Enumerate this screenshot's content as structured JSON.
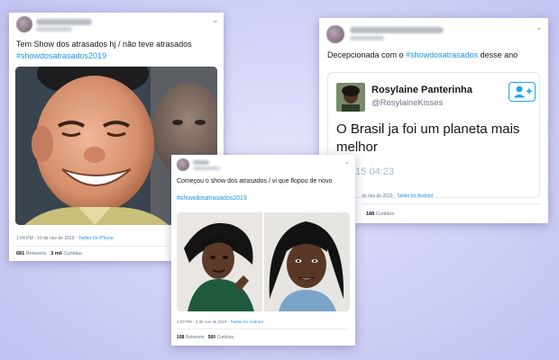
{
  "tweets": [
    {
      "text": "Tem Show dos atrasados hj / não teve atrasados",
      "hashtag": "#showdosatrasados2019",
      "time": "1:04 PM - 10 de nov de 2019",
      "client": "Twitter for iPhone",
      "retweets": "681",
      "retweets_label": "Retweets",
      "likes": "3 mil",
      "likes_label": "Curtidas"
    },
    {
      "text_before": "Decepcionada com o ",
      "hashtag": "#showdosatrasados",
      "text_after": " desse ano",
      "embed": {
        "name": "Rosylaine Panterinha",
        "handle": "@RosylaineKisses",
        "text_line1": "O Brasil ja foi um planeta mais",
        "text_line2": "melhor",
        "time": "2/15 04:23"
      },
      "time": "de nov de 2019",
      "client": "Twitter for Android",
      "likes": "188",
      "likes_label": "Curtidas"
    },
    {
      "text": "Começou o show dos atrasados / vi que flopou de novo",
      "hashtag": "#showdosatrasados2019",
      "time": "1:03 PM - 3 de nov de 2019",
      "client": "Twitter for Android",
      "retweets": "108",
      "retweets_label": "Retweets",
      "likes": "500",
      "likes_label": "Curtidas"
    }
  ],
  "icons": {
    "chevron": "chevron-down-icon",
    "follow": "add-user-icon"
  },
  "colors": {
    "background": "#c9cbf4",
    "hashtag": "#1b95e0",
    "follow_button": "#1da1f2"
  }
}
